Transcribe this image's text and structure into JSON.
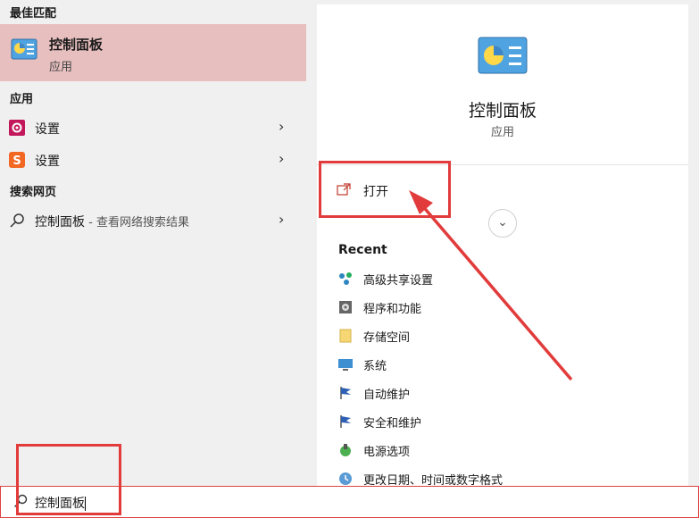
{
  "left_panel": {
    "best_match_header": "最佳匹配",
    "best_match": {
      "title": "控制面板",
      "subtitle": "应用"
    },
    "apps_header": "应用",
    "apps": [
      {
        "label": "设置",
        "icon": "gear-icon"
      },
      {
        "label": "设置",
        "icon": "sogou-settings-icon"
      }
    ],
    "web_header": "搜索网页",
    "web_result": {
      "label": "控制面板",
      "hint": " - 查看网络搜索结果"
    }
  },
  "right_panel": {
    "app_name": "控制面板",
    "app_type": "应用",
    "open_label": "打开",
    "recent_title": "Recent",
    "recent_items": [
      {
        "label": "高级共享设置",
        "icon": "network-share-icon"
      },
      {
        "label": "程序和功能",
        "icon": "programs-icon"
      },
      {
        "label": "存储空间",
        "icon": "folder-icon"
      },
      {
        "label": "系统",
        "icon": "monitor-icon"
      },
      {
        "label": "自动维护",
        "icon": "flag-icon"
      },
      {
        "label": "安全和维护",
        "icon": "flag-icon"
      },
      {
        "label": "电源选项",
        "icon": "power-icon"
      },
      {
        "label": "更改日期、时间或数字格式",
        "icon": "globe-clock-icon"
      }
    ]
  },
  "search": {
    "value": "控制面板"
  },
  "colors": {
    "highlight": "#e8bfbf",
    "annotation": "#e23b3b"
  }
}
